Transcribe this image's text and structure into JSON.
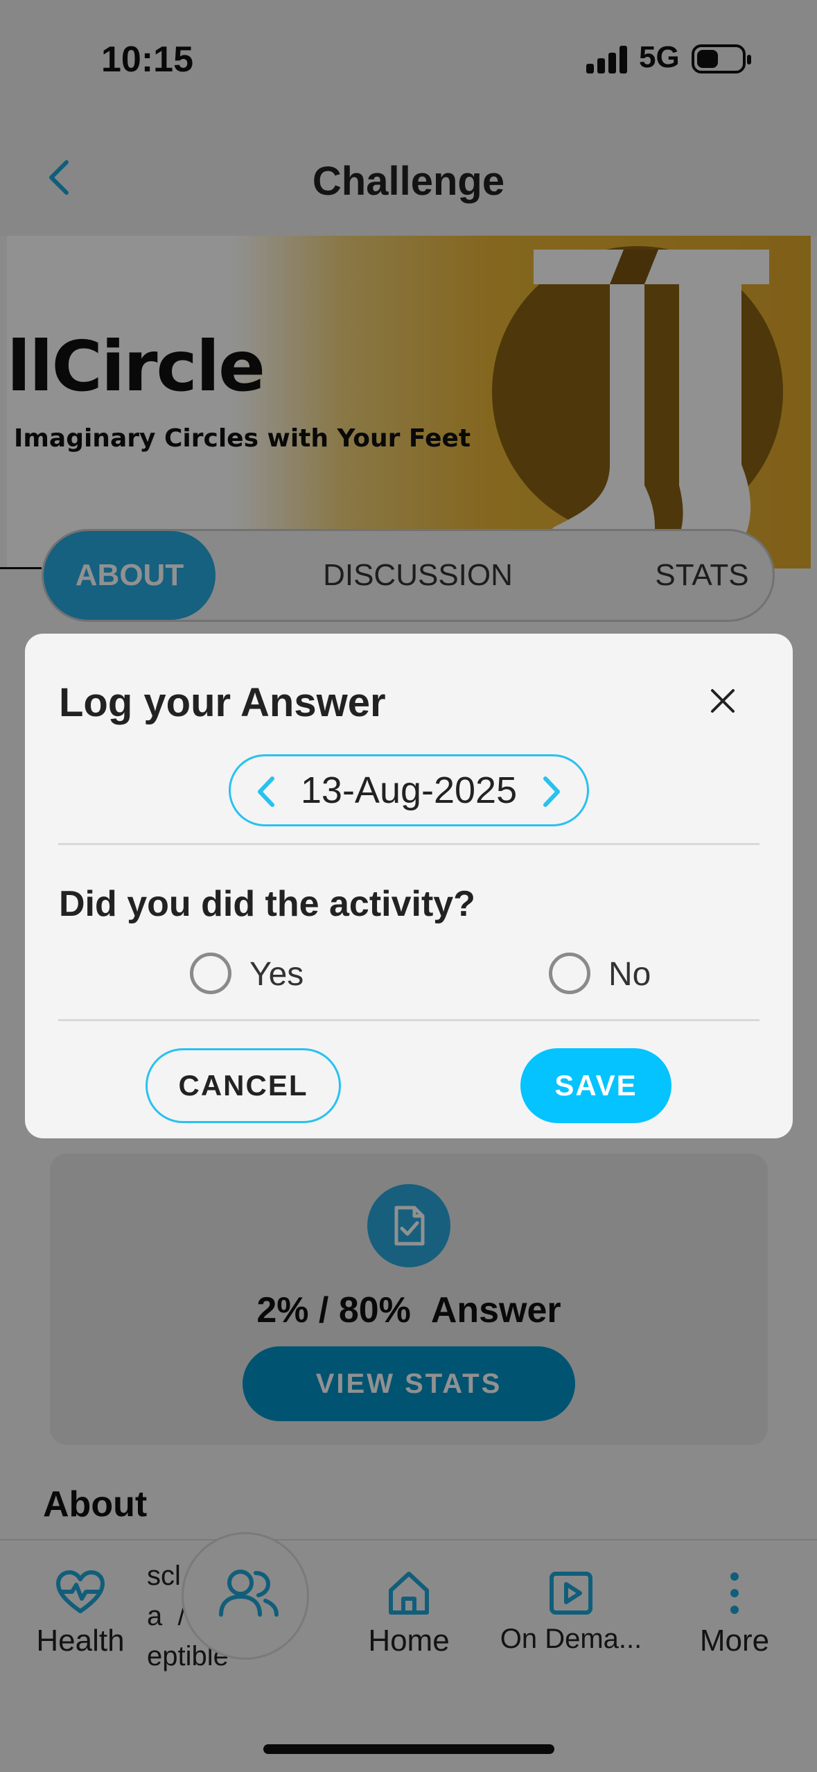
{
  "status_bar": {
    "time": "10:15",
    "network": "5G"
  },
  "header": {
    "title": "Challenge"
  },
  "banner": {
    "title": "llCircle",
    "subtitle": "Imaginary Circles with Your Feet"
  },
  "tabs": [
    {
      "label": "ABOUT",
      "active": true
    },
    {
      "label": "DISCUSSION",
      "active": false
    },
    {
      "label": "STATS",
      "active": false
    }
  ],
  "stats_card": {
    "progress": "2% / 80%",
    "label": "Answer",
    "button": "VIEW STATS"
  },
  "about": {
    "heading": "About",
    "partial_text": "scl  r ar\na  /\neptible"
  },
  "tab_bar": {
    "items": [
      {
        "label": "Health",
        "icon": "heart-pulse-icon"
      },
      {
        "label": "",
        "icon": "users-icon"
      },
      {
        "label": "Home",
        "icon": "home-icon"
      },
      {
        "label": "On Dema...",
        "icon": "play-icon"
      },
      {
        "label": "More",
        "icon": "more-vertical-icon"
      }
    ]
  },
  "modal": {
    "title": "Log your Answer",
    "date": "13-Aug-2025",
    "question": "Did you did the activity?",
    "options": [
      "Yes",
      "No"
    ],
    "cancel_label": "CANCEL",
    "save_label": "SAVE"
  },
  "colors": {
    "accent": "#04C3FF",
    "tab_active": "#27A9E1",
    "banner": "#E0A92C"
  }
}
